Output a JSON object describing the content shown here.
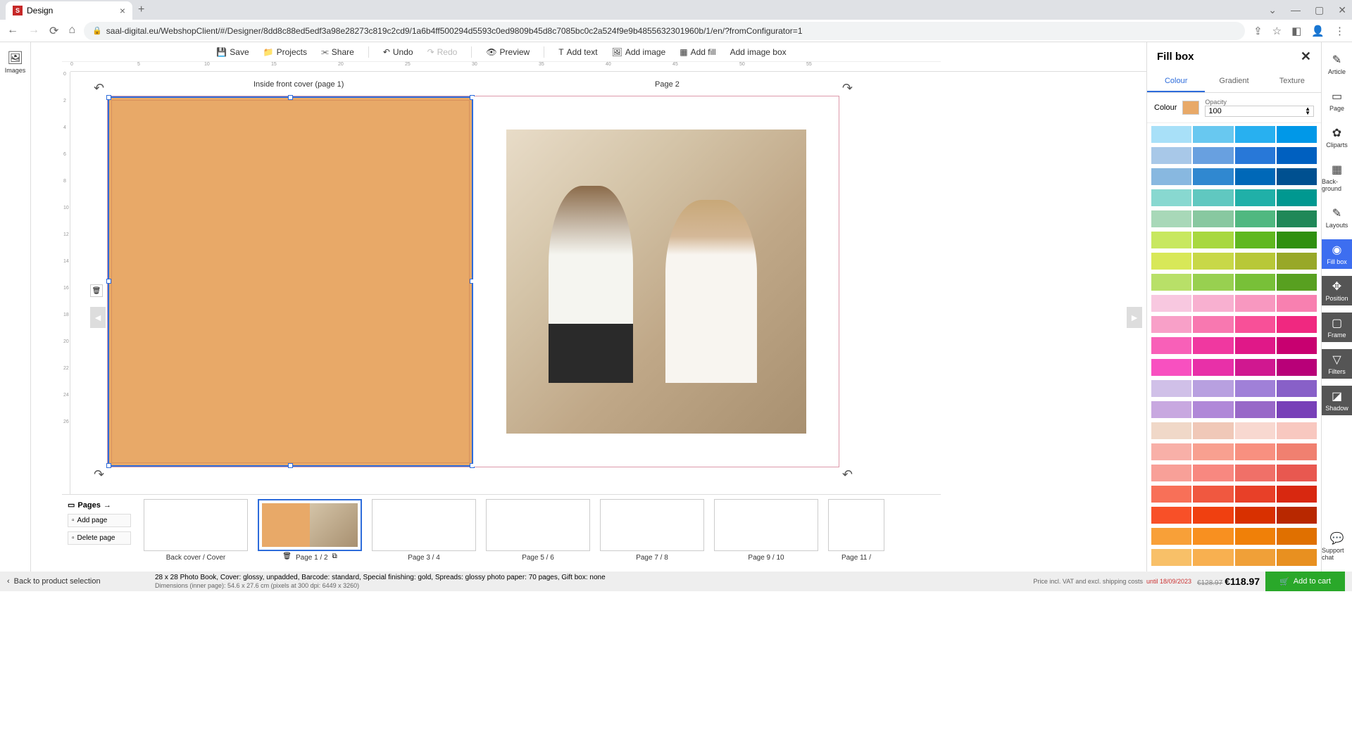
{
  "browser": {
    "tab_title": "Design",
    "url": "saal-digital.eu/WebshopClient/#/Designer/8dd8c88ed5edf3a98e28273c819c2cd9/1a6b4ff500294d5593c0ed9809b45d8c7085bc0c2a524f9e9b4855632301960b/1/en/?fromConfigurator=1"
  },
  "left_sidebar": {
    "images": "Images"
  },
  "toolbar": {
    "save": "Save",
    "projects": "Projects",
    "share": "Share",
    "undo": "Undo",
    "redo": "Redo",
    "preview": "Preview",
    "add_text": "Add text",
    "add_image": "Add image",
    "add_fill": "Add fill",
    "add_image_box": "Add image box"
  },
  "canvas": {
    "page_left_label": "Inside front cover (page 1)",
    "page_right_label": "Page 2"
  },
  "pages": {
    "title": "Pages",
    "add_page": "Add page",
    "delete_page": "Delete page",
    "thumbs": [
      {
        "label": "Back cover / Cover"
      },
      {
        "label": "Page 1 / 2"
      },
      {
        "label": "Page 3 / 4"
      },
      {
        "label": "Page 5 / 6"
      },
      {
        "label": "Page 7 / 8"
      },
      {
        "label": "Page 9 / 10"
      },
      {
        "label": "Page 11 /"
      }
    ]
  },
  "right_panel": {
    "title": "Fill box",
    "tabs": {
      "colour": "Colour",
      "gradient": "Gradient",
      "texture": "Texture"
    },
    "colour_label": "Colour",
    "opacity_label": "Opacity",
    "opacity_value": "100",
    "palette": [
      "#a8e0f8",
      "#68c8f0",
      "#28b0f0",
      "#0098e8",
      "#a8c8e8",
      "#68a0e0",
      "#2878d8",
      "#0060c0",
      "#88b8e0",
      "#3088d0",
      "#0068b8",
      "#005090",
      "#88d8d0",
      "#60c8c0",
      "#20b0a8",
      "#009890",
      "#a8d8b8",
      "#88c8a0",
      "#50b880",
      "#208858",
      "#c8e860",
      "#a8d840",
      "#60b820",
      "#309010",
      "#d8e858",
      "#c8d848",
      "#b8c838",
      "#98a828",
      "#b8e068",
      "#98d050",
      "#78c038",
      "#58a020",
      "#f8c8e0",
      "#f8b0d0",
      "#f898c0",
      "#f880b0",
      "#f8a0c8",
      "#f878b0",
      "#f85098",
      "#f02880",
      "#f860b8",
      "#f038a0",
      "#e01888",
      "#c80070",
      "#f850c0",
      "#e830a8",
      "#d01890",
      "#b80078",
      "#d0c0e8",
      "#b8a0e0",
      "#a080d8",
      "#8860c8",
      "#c8a8e0",
      "#b088d8",
      "#9868c8",
      "#7840b8",
      "#f0d8c8",
      "#f0c8b8",
      "#f8d8d0",
      "#f8c8c0",
      "#f8b0a8",
      "#f8a090",
      "#f89080",
      "#f08070",
      "#f8a098",
      "#f88880",
      "#f07068",
      "#e85850",
      "#f87058",
      "#f05840",
      "#e84028",
      "#d82810",
      "#f85028",
      "#f04010",
      "#d83000",
      "#b82800",
      "#f8a038",
      "#f89020",
      "#f08008",
      "#e07000",
      "#f8c068",
      "#f8b050",
      "#f0a038",
      "#e89020"
    ]
  },
  "right_toolbar": {
    "article": "Article",
    "page": "Page",
    "cliparts": "Cliparts",
    "background": "Back-ground",
    "layouts": "Layouts",
    "fillbox": "Fill box",
    "position": "Position",
    "frame": "Frame",
    "filters": "Filters",
    "shadow": "Shadow",
    "support": "Support chat"
  },
  "bottom": {
    "back": "Back to product selection",
    "product": "28 x 28 Photo Book, Cover: glossy, unpadded, Barcode: standard, Special finishing: gold, Spreads: glossy photo paper: 70 pages, Gift box: none",
    "dimensions": "Dimensions (inner page): 54.6 x 27.6 cm (pixels at 300 dpi: 6449 x 3260)",
    "price_note": "Price incl. VAT and excl. shipping costs",
    "valid_until": "until 18/09/2023",
    "old_price": "€128.97",
    "new_price": "€118.97",
    "add_to_cart": "Add to cart"
  }
}
